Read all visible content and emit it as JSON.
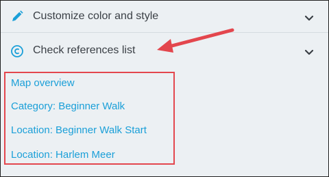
{
  "sections": [
    {
      "label": "Customize color and style",
      "icon": "pencil-icon"
    },
    {
      "label": "Check references list",
      "icon": "copyright-circle-icon"
    }
  ],
  "references": [
    "Map overview",
    "Category: Beginner Walk",
    "Location: Beginner Walk Start",
    "Location: Harlem Meer"
  ],
  "colors": {
    "panel_bg": "#ecf0f3",
    "text": "#3a3f45",
    "link": "#1a9fd8",
    "highlight_box": "#e3464d",
    "annotation_arrow": "#e3464d",
    "icon": "#1a9fd8"
  }
}
